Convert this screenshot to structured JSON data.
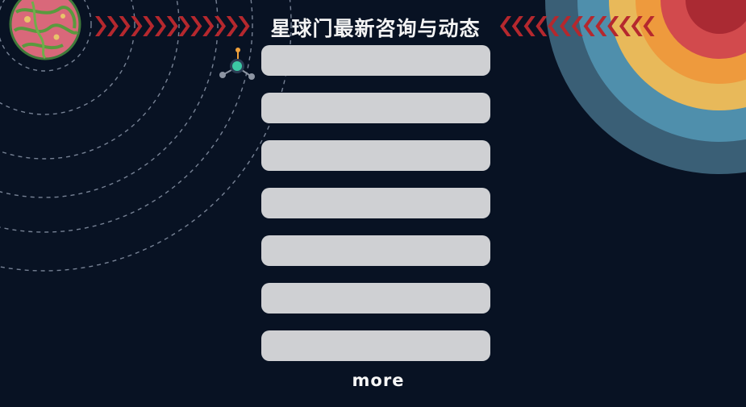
{
  "header": {
    "title": "星球门最新咨询与动态"
  },
  "news": {
    "items": [
      {
        "text": ""
      },
      {
        "text": ""
      },
      {
        "text": ""
      },
      {
        "text": ""
      },
      {
        "text": ""
      },
      {
        "text": ""
      },
      {
        "text": ""
      }
    ]
  },
  "footer": {
    "more_label": "more"
  },
  "colors": {
    "background": "#081223",
    "chevron": "#b5282e",
    "ring_red": "#d24a4d",
    "ring_orange": "#ee9a3d",
    "ring_yellow": "#e8b95a",
    "ring_blue": "#4f8fac",
    "ring_slate": "#3a5f76",
    "card": "#cfd0d3",
    "text": "#f4f4f4"
  },
  "icons": {
    "planet": "planet-icon",
    "satellite": "satellite-icon"
  }
}
